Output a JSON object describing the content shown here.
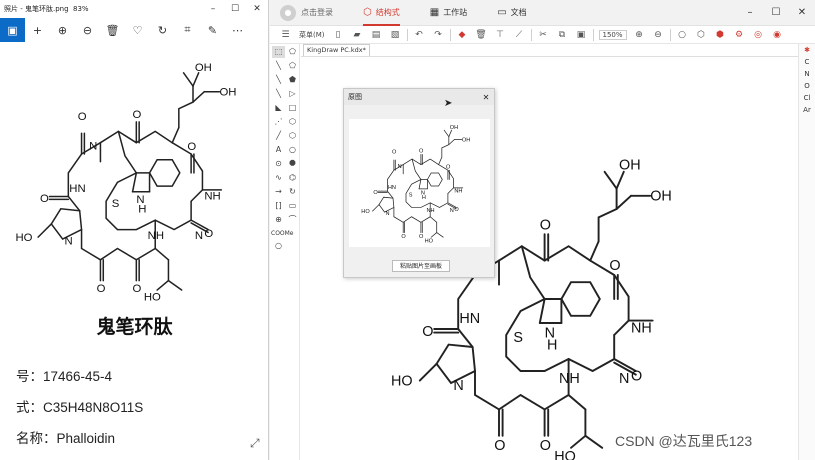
{
  "photos": {
    "title": "照片 - 鬼笔环肽.png",
    "zoom": "83%",
    "toolbar": [
      "crop-edit",
      "add",
      "zoom-in",
      "zoom-out",
      "delete",
      "favorite",
      "rotate",
      "crop",
      "edit",
      "more"
    ],
    "compound_name": "鬼笔环肽",
    "cas": "号：17466-45-4",
    "formula": "式：C35H48N8O11S",
    "name_line": "名称：Phalloidin"
  },
  "kingdraw": {
    "login": "点击登录",
    "tabs": [
      "结构式",
      "工作站",
      "文档"
    ],
    "menu": "菜单(M)",
    "zoom": "150%",
    "doc_tab": "KingDraw PC.kdx*",
    "coome": "COOMe",
    "elements": [
      "✱",
      "C",
      "N",
      "O",
      "Cl",
      "Ar"
    ],
    "dialog": {
      "title": "原图",
      "button": "粘贴图片至画板"
    }
  },
  "molecule_labels": {
    "oh": "OH",
    "nh": "NH",
    "hn": "HN",
    "n": "N",
    "h": "H",
    "s": "S",
    "o": "O",
    "ho": "HO"
  },
  "watermark": "CSDN @达瓦里氏123"
}
